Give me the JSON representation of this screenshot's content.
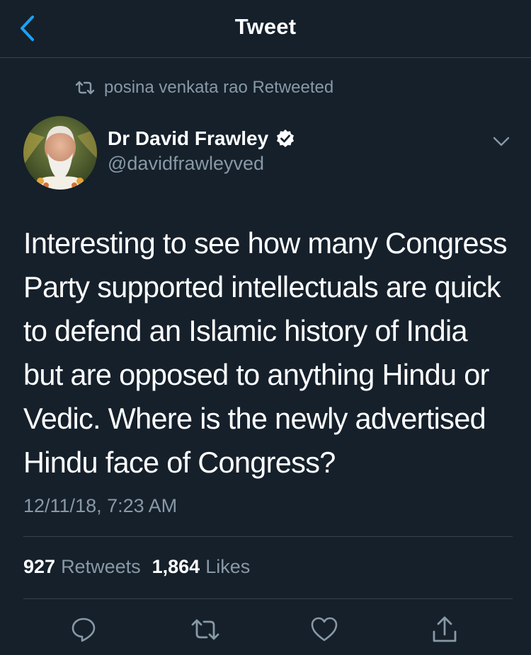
{
  "header": {
    "title": "Tweet",
    "back_icon": "chevron-left-icon"
  },
  "retweet_context": {
    "icon": "retweet-icon",
    "text": "posina venkata rao Retweeted"
  },
  "tweet": {
    "author": {
      "name": "Dr David Frawley",
      "handle": "@davidfrawleyved",
      "verified": true
    },
    "text": "Interesting to see how many Congress Party supported intellectuals are quick to defend an Islamic history of India but are opposed to anything Hindu or Vedic. Where is the newly advertised Hindu face of Congress?",
    "timestamp": "12/11/18, 7:23 AM",
    "stats": {
      "retweets_count": "927",
      "retweets_label": "Retweets",
      "likes_count": "1,864",
      "likes_label": "Likes"
    }
  },
  "actions": [
    "reply-icon",
    "retweet-icon",
    "like-icon",
    "share-icon"
  ],
  "colors": {
    "background": "#15202b",
    "accent": "#1da1f2",
    "secondary_text": "#8899a6",
    "divider": "#38444d"
  }
}
